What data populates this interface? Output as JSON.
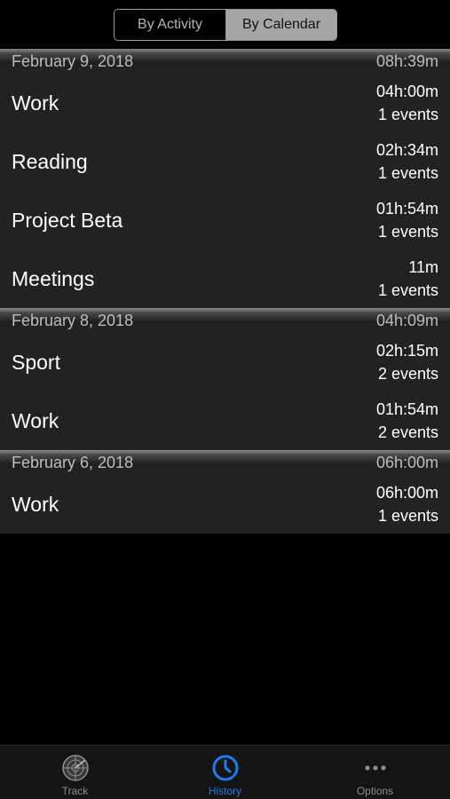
{
  "segment": {
    "by_activity": "By Activity",
    "by_calendar": "By Calendar"
  },
  "sections": [
    {
      "date": "February 9, 2018",
      "total": "08h:39m",
      "rows": [
        {
          "title": "Work",
          "duration": "04h:00m",
          "events": "1 events"
        },
        {
          "title": "Reading",
          "duration": "02h:34m",
          "events": "1 events"
        },
        {
          "title": "Project Beta",
          "duration": "01h:54m",
          "events": "1 events"
        },
        {
          "title": "Meetings",
          "duration": "11m",
          "events": "1 events"
        }
      ]
    },
    {
      "date": "February 8, 2018",
      "total": "04h:09m",
      "rows": [
        {
          "title": "Sport",
          "duration": "02h:15m",
          "events": "2 events"
        },
        {
          "title": "Work",
          "duration": "01h:54m",
          "events": "2 events"
        }
      ]
    },
    {
      "date": "February 6, 2018",
      "total": "06h:00m",
      "rows": [
        {
          "title": "Work",
          "duration": "06h:00m",
          "events": "1 events"
        }
      ]
    }
  ],
  "tabbar": {
    "track": {
      "label": "Track",
      "icon": "radar-icon"
    },
    "history": {
      "label": "History",
      "icon": "clock-icon"
    },
    "options": {
      "label": "Options",
      "icon": "more-dots-icon"
    }
  },
  "colors": {
    "accent": "#1e7cf2",
    "row_bg": "#222222",
    "background": "#000000"
  }
}
